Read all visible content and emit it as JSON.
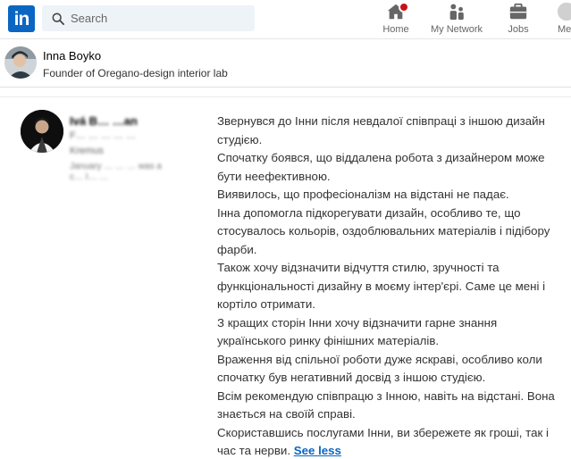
{
  "nav": {
    "logo_text": "in",
    "search": {
      "placeholder": "Search"
    },
    "items": [
      {
        "label": "Home",
        "icon": "home-icon",
        "badge": true
      },
      {
        "label": "My Network",
        "icon": "network-icon"
      },
      {
        "label": "Jobs",
        "icon": "briefcase-icon"
      },
      {
        "label": "Me",
        "icon": "avatar-icon"
      }
    ]
  },
  "profile": {
    "name": "Inna Boyko",
    "headline": "Founder of Oregano-design interior lab"
  },
  "recommendation": {
    "reviewer": {
      "name": "Ivá B… …an",
      "line1": "F… … … … …",
      "line2": "Kremus",
      "line3": "January … … … was a",
      "line4": "c… I… …"
    },
    "paragraphs": [
      "Звернувся до Інни після невдалої співпраці з іншою дизайн студією.",
      "Спочатку боявся, що віддалена робота з дизайнером може бути неефективною.",
      "Виявилось, що професіоналізм на відстані не падає.",
      "Інна допомогла підкорегувати дизайн, особливо те, що стосувалось кольорів, оздоблювальних матеріалів і підібору фарби.",
      "Також хочу відзначити відчуття стилю, зручності та функціональності дизайну в моєму інтер'єрі. Саме це мені і кортіло отримати.",
      "З кращих сторін Інни хочу відзначити гарне знання українського ринку фінішних матеріалів.",
      "Враження від спільної роботи дуже яскраві, особливо коли спочатку був негативний досвід з іншою студією.",
      "Всім рекомендую співпрацю з Інною, навіть на відстані. Вона знається на своїй справі.",
      "Скориставшись послугами Інни, ви збережете як гроші, так і час та нерви."
    ],
    "see_less_label": "See less"
  },
  "colors": {
    "brand": "#0a66c2",
    "badge": "#cc1016",
    "search_bg": "#eef3f8"
  }
}
